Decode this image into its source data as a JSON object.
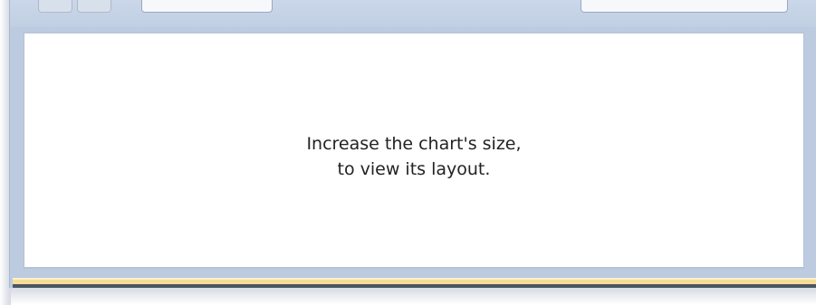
{
  "content_panel": {
    "message_line_1": "Increase the chart's size,",
    "message_line_2": "to view its layout."
  }
}
